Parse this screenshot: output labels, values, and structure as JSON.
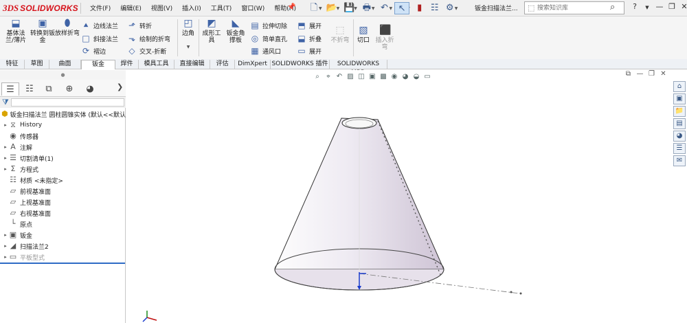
{
  "app": {
    "logo_prefix": "3DS",
    "logo_text": "SOLIDWORKS",
    "menus": [
      "文件(F)",
      "编辑(E)",
      "视图(V)",
      "插入(I)",
      "工具(T)",
      "窗口(W)",
      "帮助(H)"
    ],
    "document_title": "钣金扫描法兰...",
    "search_placeholder": "搜索知识库",
    "help_label": "?"
  },
  "commands": {
    "base_flange": "基体法兰/薄片",
    "convert_to_sheet": "转换到钣金",
    "lofted_bend": "放样折弯",
    "edge_flange": "边线法兰",
    "miter_flange": "斜接法兰",
    "hem": "褶边",
    "jog": "转折",
    "sketched_bend": "绘制的折弯",
    "cross_break": "交叉-折断",
    "corners": "边角",
    "forming_tool": "成形工具",
    "sheet_metal_gusset": "钣金角撑板",
    "extruded_cut": "拉伸切除",
    "simple_hole": "简单直孔",
    "vent": "通风口",
    "unfold": "展开",
    "fold": "折叠",
    "flatten": "展开",
    "no_bends": "不折弯",
    "rip": "切口",
    "insert_bends": "插入折弯"
  },
  "tabs": [
    "特征",
    "草图",
    "曲面",
    "钣金",
    "焊件",
    "模具工具",
    "直接编辑",
    "评估",
    "DimXpert",
    "SOLIDWORKS 插件",
    "SOLIDWORKS MBD"
  ],
  "active_tab": "钣金",
  "feature_tree": {
    "root": "钣金扫描法兰 圆柱圆锥实体 (默认<<默认",
    "items": [
      {
        "label": "History",
        "icon": "history-icon",
        "expandable": true
      },
      {
        "label": "传感器",
        "icon": "sensor-icon",
        "expandable": false
      },
      {
        "label": "注解",
        "icon": "annotation-icon",
        "expandable": true
      },
      {
        "label": "切割清单(1)",
        "icon": "cut-list-icon",
        "expandable": true
      },
      {
        "label": "方程式",
        "icon": "equation-icon",
        "expandable": true
      },
      {
        "label": "材质 <未指定>",
        "icon": "material-icon",
        "expandable": false
      },
      {
        "label": "前视基准面",
        "icon": "plane-icon",
        "expandable": false
      },
      {
        "label": "上视基准面",
        "icon": "plane-icon",
        "expandable": false
      },
      {
        "label": "右视基准面",
        "icon": "plane-icon",
        "expandable": false
      },
      {
        "label": "原点",
        "icon": "origin-icon",
        "expandable": false
      },
      {
        "label": "钣金",
        "icon": "sheet-metal-icon",
        "expandable": true
      },
      {
        "label": "扫描法兰2",
        "icon": "swept-flange-icon",
        "expandable": true
      },
      {
        "label": "平板型式",
        "icon": "flat-pattern-icon",
        "expandable": true,
        "suppressed": true
      }
    ]
  },
  "colors": {
    "accent": "#2e6bc5",
    "brand": "#d6121a",
    "model_fill": "#e9e6ee"
  }
}
